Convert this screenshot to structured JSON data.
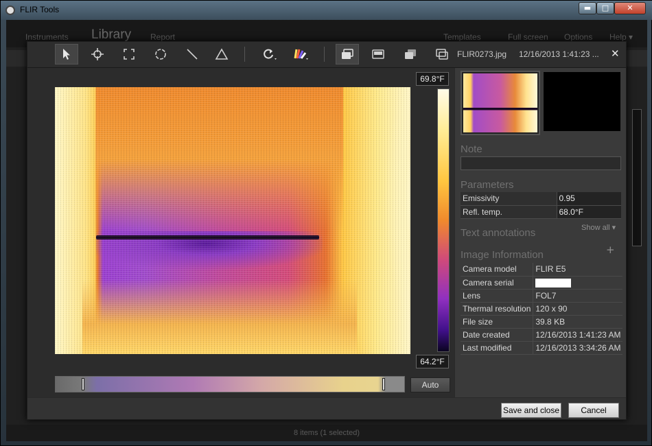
{
  "window": {
    "title": "FLIR Tools",
    "controls": {
      "minimize": "▬",
      "maximize": "□",
      "close": "✕"
    }
  },
  "app": {
    "menu": {
      "instruments": "Instruments",
      "library": "Library",
      "report": "Report",
      "templates": "Templates",
      "fullscreen": "Full screen",
      "options": "Options",
      "help": "Help ▾"
    },
    "status": "8 items   (1 selected)"
  },
  "dialog": {
    "file_name": "FLIR0273.jpg",
    "file_date": "12/16/2013 1:41:23 ...",
    "close_label": "✕",
    "tools": [
      "select-arrow",
      "spot-meter",
      "box-area",
      "circle-area",
      "line-profile",
      "delta-triangle",
      "rotate",
      "palette",
      "view-ir",
      "view-visual",
      "view-msx",
      "view-pip"
    ],
    "temp_max": "69.8°F",
    "temp_min": "64.2°F",
    "auto_label": "Auto",
    "note_title": "Note",
    "parameters_title": "Parameters",
    "parameters": [
      {
        "label": "Emissivity",
        "value": "0.95"
      },
      {
        "label": "Refl. temp.",
        "value": "68.0°F"
      }
    ],
    "show_all": "Show all ▾",
    "text_annotations_title": "Text annotations",
    "plus": "+",
    "image_info_title": "Image Information",
    "image_info": [
      {
        "label": "Camera model",
        "value": "FLIR E5"
      },
      {
        "label": "Camera serial",
        "value": ""
      },
      {
        "label": "Lens",
        "value": "FOL7"
      },
      {
        "label": "Thermal resolution",
        "value": "120 x 90"
      },
      {
        "label": "File size",
        "value": "39.8 KB"
      },
      {
        "label": "Date created",
        "value": "12/16/2013 1:41:23 AM"
      },
      {
        "label": "Last modified",
        "value": "12/16/2013 3:34:26 AM"
      }
    ],
    "save_label": "Save and close",
    "cancel_label": "Cancel"
  },
  "colors": {
    "palette_hot": "#fff7c6",
    "palette_mid": "#f08a2c",
    "palette_cold": "#40108a",
    "dialog_bg": "#3a3a3a"
  }
}
